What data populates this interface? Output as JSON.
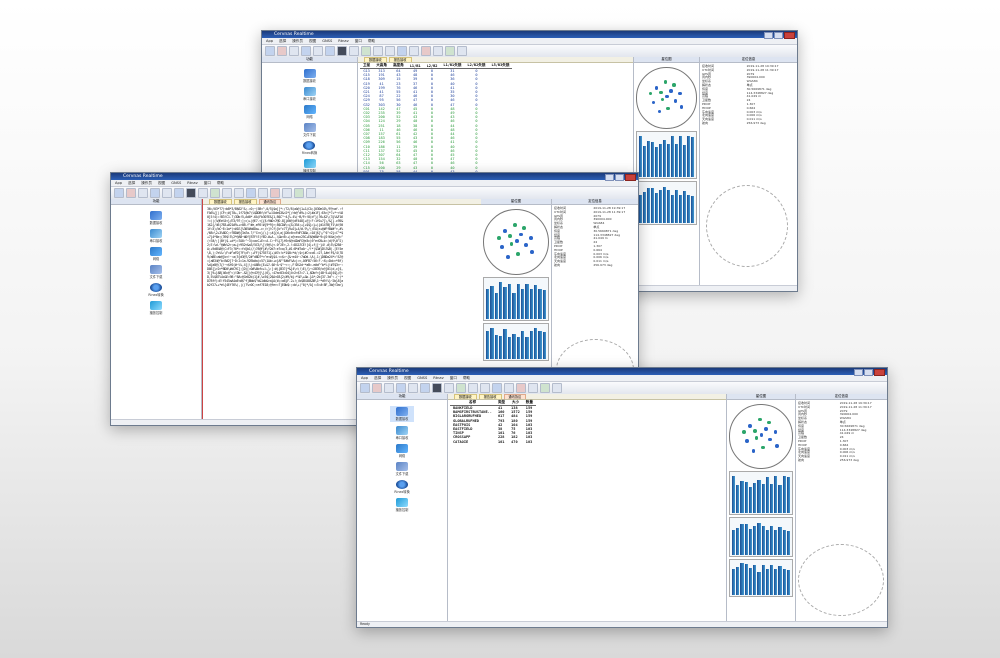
{
  "window_title": "Cervnas Realtime",
  "menu": [
    "App",
    "选择",
    "操作员",
    "视图",
    "GNSS",
    "Rtnav",
    "窗口",
    "帮助"
  ],
  "left_panel": {
    "header": "功能",
    "items": [
      "数据接收",
      "串口接收",
      "网络",
      "文件下载",
      "Rinex转换",
      "播放控制"
    ]
  },
  "tabs": [
    "数据接收",
    "报告接收",
    "通讯协议"
  ],
  "right_panel": {
    "sky_title": "星位图",
    "info_title": "定位信息"
  },
  "window1": {
    "columns": [
      "卫星",
      "大高角",
      "高度角",
      "L1/B1",
      "L2/B2",
      "L1/B1失锁",
      "L2/B2失锁",
      "L5/B3失锁"
    ],
    "rows": [
      [
        "G13",
        "313",
        "64",
        "49",
        "0",
        "31",
        "0"
      ],
      [
        "G15",
        "191",
        "43",
        "48",
        "0",
        "46",
        "0"
      ],
      [
        "G18",
        "309",
        "15",
        "39",
        "0",
        "36",
        "0"
      ],
      [
        "G19",
        "41",
        "23",
        "37",
        "0",
        "40",
        "0"
      ],
      [
        "G20",
        "199",
        "76",
        "46",
        "0",
        "41",
        "0"
      ],
      [
        "G21",
        "41",
        "55",
        "41",
        "0",
        "35",
        "0"
      ],
      [
        "G24",
        "87",
        "22",
        "46",
        "0",
        "30",
        "0"
      ],
      [
        "G29",
        "95",
        "56",
        "47",
        "0",
        "46",
        "0"
      ],
      [
        "G32",
        "303",
        "30",
        "46",
        "0",
        "47",
        "0"
      ],
      [
        "C01",
        "142",
        "47",
        "45",
        "0",
        "48",
        "0"
      ],
      [
        "C02",
        "235",
        "39",
        "41",
        "0",
        "49",
        "0"
      ],
      [
        "C03",
        "200",
        "52",
        "43",
        "0",
        "43",
        "0"
      ],
      [
        "C04",
        "124",
        "29",
        "40",
        "0",
        "46",
        "0"
      ],
      [
        "C05",
        "251",
        "18",
        "38",
        "0",
        "44",
        "0"
      ],
      [
        "C06",
        "11",
        "46",
        "46",
        "0",
        "48",
        "0"
      ],
      [
        "C07",
        "157",
        "61",
        "42",
        "0",
        "44",
        "0"
      ],
      [
        "C08",
        "183",
        "55",
        "43",
        "0",
        "46",
        "0"
      ],
      [
        "C09",
        "226",
        "56",
        "46",
        "0",
        "41",
        "0"
      ],
      [
        "C10",
        "186",
        "11",
        "39",
        "0",
        "40",
        "0"
      ],
      [
        "C11",
        "137",
        "52",
        "45",
        "0",
        "46",
        "0"
      ],
      [
        "C12",
        "307",
        "64",
        "47",
        "0",
        "45",
        "0"
      ],
      [
        "C13",
        "154",
        "32",
        "40",
        "0",
        "47",
        "0"
      ],
      [
        "C14",
        "56",
        "63",
        "47",
        "0",
        "46",
        "0"
      ],
      [
        "C15",
        "200",
        "29",
        "43",
        "0",
        "40",
        "0"
      ],
      [
        "E01",
        "75",
        "58",
        "44",
        "0",
        "43",
        "0"
      ]
    ]
  },
  "window3": {
    "columns": [
      "名称",
      "类型",
      "大小",
      "数量"
    ],
    "rows": [
      [
        "BANKFIELD",
        "41",
        "138",
        "159"
      ],
      [
        "BAMGFIRSTBUSTANE..",
        "160",
        "1572",
        "159"
      ],
      [
        "BIGLARGRUFHED",
        "617",
        "484",
        "159"
      ],
      [
        "GLOBALRUFHED",
        "793",
        "180",
        "159"
      ],
      [
        "EASTPOIS",
        "42",
        "104",
        "103"
      ],
      [
        "EASTFIELD",
        "38",
        "75",
        "103"
      ],
      [
        "TINSP",
        "101",
        "76",
        "103"
      ],
      [
        "CROSSAPP",
        "228",
        "182",
        "103"
      ],
      [
        "CATAOIE",
        "101",
        "470",
        "103"
      ]
    ],
    "status": "Ready"
  },
  "info_rows": [
    [
      "接收时间",
      "2019-11-28 19:39:17"
    ],
    [
      "UTC时间",
      "2019-11-28 11:39:17"
    ],
    [
      "GPS周",
      "2079"
    ],
    [
      "周内秒",
      "390004.000"
    ],
    [
      "坐标系",
      "WGS84"
    ],
    [
      "解状态",
      "单点"
    ],
    [
      "纬度",
      "30.5669871 deg"
    ],
    [
      "经度",
      "114.3348827 deg"
    ],
    [
      "高程",
      "41.049 m"
    ],
    [
      "卫星数",
      "24"
    ],
    [
      "PDOP",
      "1.307"
    ],
    [
      "HDOP",
      "0.664"
    ],
    [
      "东向速度",
      "0.003 m/s"
    ],
    [
      "北向速度",
      "0.006 m/s"
    ],
    [
      "天向速度",
      "0.011 m/s"
    ],
    [
      "航向",
      "256.973 deg"
    ]
  ],
  "colors": {
    "title_bar": "#1b3a7a",
    "accent": "#2f6fce",
    "bar": "#1b4e93",
    "sat_blue": "#2a64c8",
    "sat_green": "#2ba56a"
  }
}
